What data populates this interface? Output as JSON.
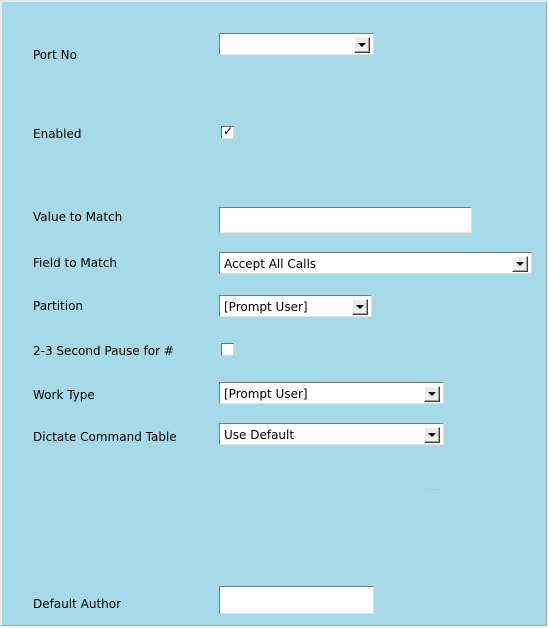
{
  "form": {
    "port_no": {
      "label": "Port No",
      "value": ""
    },
    "enabled": {
      "label": "Enabled",
      "checked": true,
      "mark": "✓"
    },
    "value_to_match": {
      "label": "Value to Match",
      "value": ""
    },
    "field_to_match": {
      "label": "Field to Match",
      "value": "Accept All Calls"
    },
    "partition": {
      "label": "Partition",
      "value": "[Prompt User]"
    },
    "pause": {
      "label": "2-3 Second Pause for #",
      "checked": false
    },
    "work_type": {
      "label": "Work Type",
      "value": "[Prompt User]"
    },
    "dictate_command_table": {
      "label": "Dictate Command Table",
      "value": "Use Default"
    },
    "default_author": {
      "label": "Default Author",
      "value": ""
    }
  },
  "colors": {
    "panel_background": "#a6dae8",
    "field_background": "#ffffff"
  },
  "icons": {
    "dropdown": "chevron-down-icon",
    "checkbox_mark": "check-icon"
  }
}
